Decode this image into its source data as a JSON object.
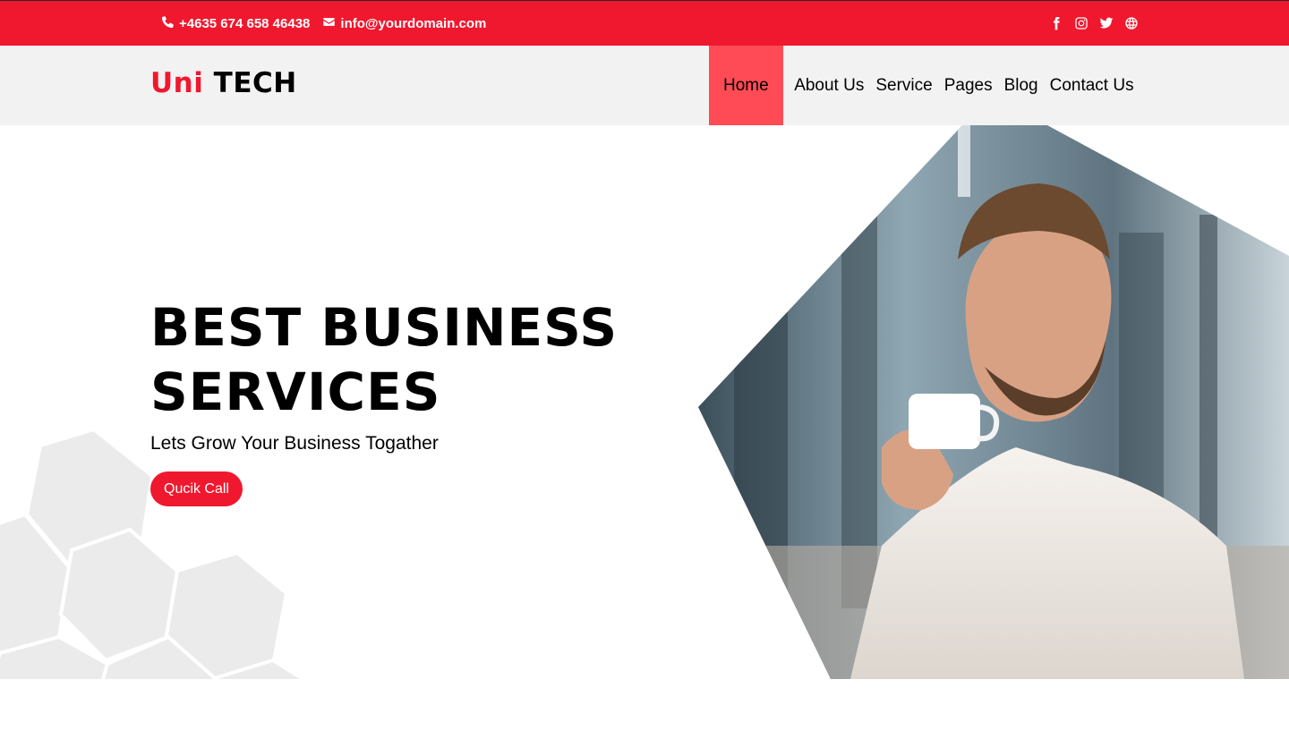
{
  "topbar": {
    "phone": "+4635 674 658 46438",
    "email": "info@yourdomain.com",
    "social_icons": [
      "facebook-icon",
      "instagram-icon",
      "twitter-icon",
      "globe-icon"
    ]
  },
  "brand": {
    "part1": "Uni",
    "part2": "TECH"
  },
  "nav": {
    "items": [
      {
        "label": "Home",
        "active": true
      },
      {
        "label": "About Us"
      },
      {
        "label": "Service"
      },
      {
        "label": "Pages"
      },
      {
        "label": "Blog"
      },
      {
        "label": "Contact Us"
      }
    ]
  },
  "hero": {
    "title_line1": "BEST BUSINESS",
    "title_line2": "SERVICES",
    "subtitle": "Lets Grow Your Business Togather",
    "cta_label": "Qucik Call"
  },
  "colors": {
    "brand_red": "#f0182e",
    "nav_active": "#ff4b55",
    "nav_bg": "#f2f2f2",
    "hex_gray": "#ebebeb"
  }
}
